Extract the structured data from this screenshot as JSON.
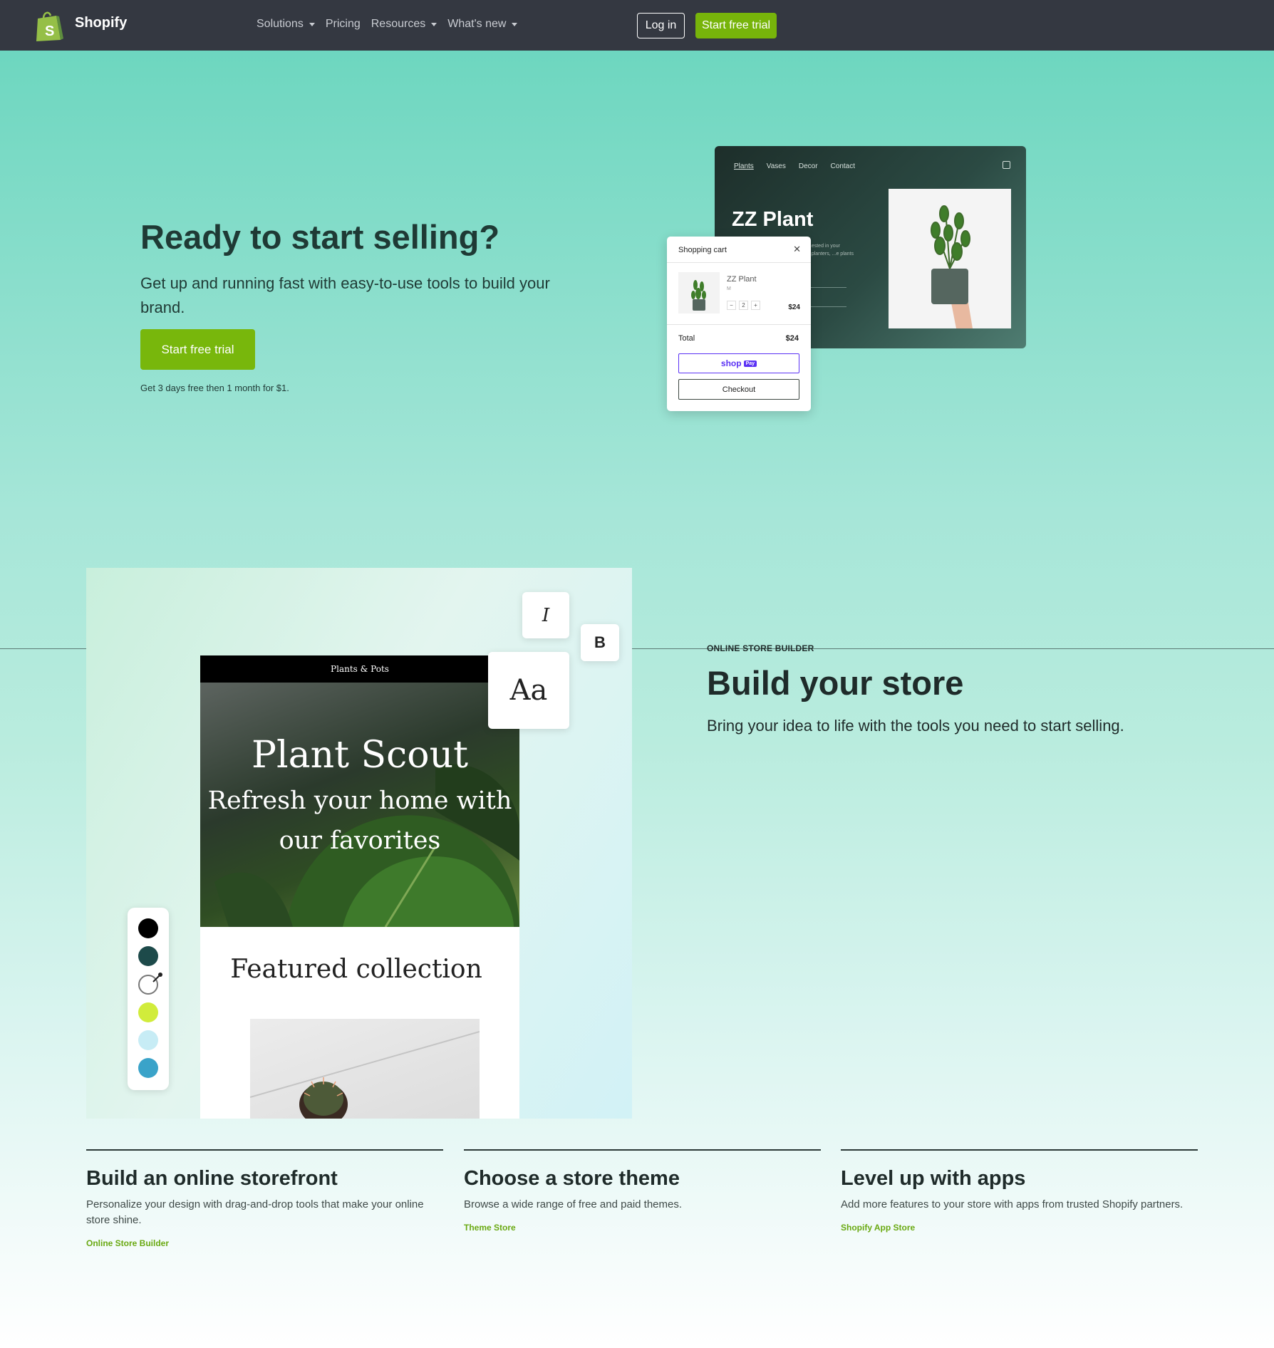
{
  "nav": {
    "brand": "Shopify",
    "links": [
      {
        "label": "Solutions",
        "dropdown": true
      },
      {
        "label": "Pricing",
        "dropdown": false
      },
      {
        "label": "Resources",
        "dropdown": true
      },
      {
        "label": "What's new",
        "dropdown": true
      }
    ],
    "login": "Log in",
    "trial": "Start free trial"
  },
  "hero": {
    "title": "Ready to start selling?",
    "subtitle": "Get up and running fast with easy-to-use tools to build your brand.",
    "cta": "Start free trial",
    "note": "Get 3 days free then 1 month for $1."
  },
  "store_mock": {
    "nav": [
      "Plants",
      "Vases",
      "Decor",
      "Contact"
    ],
    "title": "ZZ Plant",
    "text": "...ested in your ...planters, ...e plants"
  },
  "cart": {
    "title": "Shopping cart",
    "item_name": "ZZ Plant",
    "item_size": "M",
    "qty_minus": "−",
    "qty": "2",
    "qty_plus": "+",
    "item_price": "$24",
    "total_label": "Total",
    "total": "$24",
    "shop_pay": "shop",
    "shop_pay_badge": "Pay",
    "checkout": "Checkout"
  },
  "builder": {
    "theme_header": "Plants & Pots",
    "theme_title": "Plant Scout",
    "theme_tagline": "Refresh your home with our favorites",
    "featured": "Featured collection",
    "tool_italic": "I",
    "tool_bold": "B",
    "tool_font": "Aa",
    "swatches": [
      "#000000",
      "#1d4a4a",
      "#ffffff",
      "#d1ec3b",
      "#c7ecf5",
      "#3aa3c9"
    ],
    "eyebrow": "ONLINE STORE BUILDER",
    "title": "Build your store",
    "subtitle": "Bring your idea to life with the tools you need to start selling."
  },
  "features": [
    {
      "title": "Build an online storefront",
      "desc": "Personalize your design with drag-and-drop tools that make your online store shine.",
      "link": "Online Store Builder"
    },
    {
      "title": "Choose a store theme",
      "desc": "Browse a wide range of free and paid themes.",
      "link": "Theme Store"
    },
    {
      "title": "Level up with apps",
      "desc": "Add more features to your store with apps from trusted Shopify partners.",
      "link": "Shopify App Store"
    }
  ],
  "colors": {
    "nav_bg": "#343841",
    "accent_green": "#77b40a",
    "link_green": "#6aa912",
    "shop_pay": "#5a31f4"
  }
}
